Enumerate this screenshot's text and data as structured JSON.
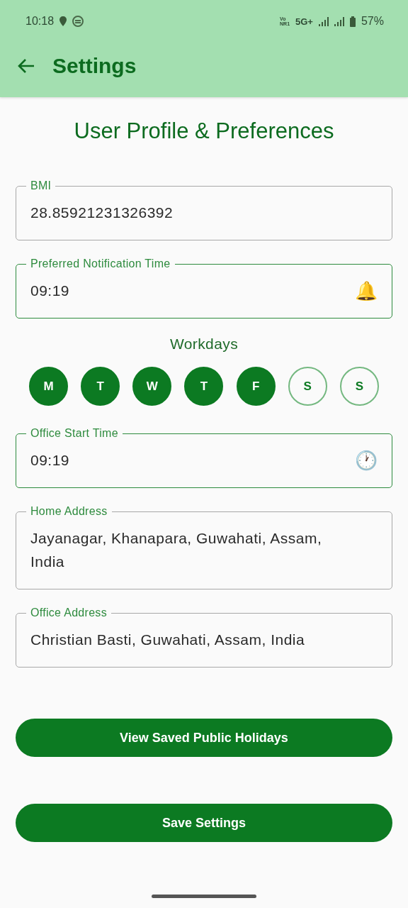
{
  "status_bar": {
    "time": "10:18",
    "volte_top": "Vo",
    "volte_bottom": "NR1",
    "network": "5G+",
    "battery": "57%"
  },
  "app_bar": {
    "title": "Settings"
  },
  "heading": "User Profile & Preferences",
  "fields_top": [
    {
      "kind": "text",
      "label": "BMI",
      "value": "28.85921231326392"
    },
    {
      "kind": "time",
      "icon": "🔔",
      "label": "Preferred Notification Time",
      "value": "09:19"
    }
  ],
  "workdays": {
    "title": "Workdays",
    "days": [
      {
        "label": "M",
        "selected": true
      },
      {
        "label": "T",
        "selected": true
      },
      {
        "label": "W",
        "selected": true
      },
      {
        "label": "T",
        "selected": true
      },
      {
        "label": "F",
        "selected": true
      },
      {
        "label": "S",
        "selected": false
      },
      {
        "label": "S",
        "selected": false
      }
    ]
  },
  "fields_bottom": [
    {
      "kind": "time",
      "icon": "🕐",
      "label": "Office Start Time",
      "value": "09:19"
    },
    {
      "kind": "text",
      "label": "Home Address",
      "value": "Jayanagar, Khanapara, Guwahati, Assam, India"
    },
    {
      "kind": "text",
      "label": "Office Address",
      "value": "Christian Basti, Guwahati, Assam, India"
    }
  ],
  "buttons": [
    "View Saved Public Holidays",
    "Save Settings"
  ]
}
